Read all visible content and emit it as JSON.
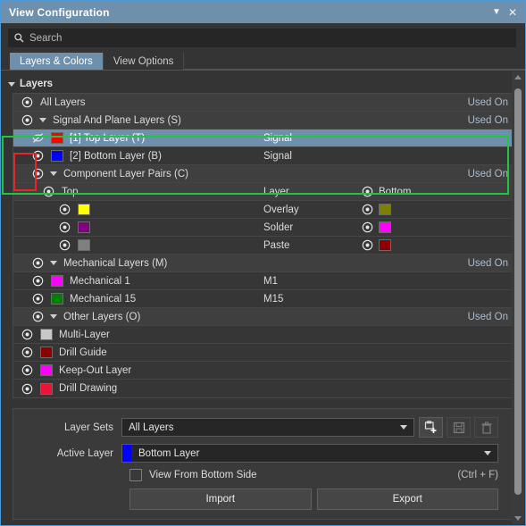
{
  "window": {
    "title": "View Configuration",
    "collapse_icon": "chevron-down-icon",
    "close_icon": "close-icon",
    "titlebar_color": "#6e90ad"
  },
  "search": {
    "placeholder": "Search",
    "value": "",
    "icon": "search-icon"
  },
  "tabs": [
    {
      "label": "Layers & Colors",
      "active": true
    },
    {
      "label": "View Options",
      "active": false
    }
  ],
  "layers_group": {
    "label": "Layers",
    "expanded": true
  },
  "columns": {
    "layer": "Layer",
    "bottom": "Bottom",
    "top": "Top"
  },
  "used_on_label": "Used On",
  "tree": [
    {
      "kind": "group",
      "indent": 0,
      "label": "All Layers",
      "eye": "visible",
      "used_on": true,
      "expander": false
    },
    {
      "kind": "group",
      "indent": 0,
      "label": "Signal And Plane Layers (S)",
      "eye": "visible",
      "used_on": true,
      "expander": true,
      "expanded": true
    },
    {
      "kind": "leaf",
      "indent": 1,
      "label": "[1] Top Layer (T)",
      "eye": "hidden",
      "swatch": "#ff0000",
      "layer_type": "Signal",
      "selected": true
    },
    {
      "kind": "leaf",
      "indent": 1,
      "label": "[2] Bottom Layer (B)",
      "eye": "visible",
      "swatch": "#0000ff",
      "layer_type": "Signal",
      "selected": false
    },
    {
      "kind": "group",
      "indent": 1,
      "label": "Component Layer Pairs (C)",
      "eye": "visible",
      "used_on": true,
      "expander": true,
      "expanded": true
    },
    {
      "kind": "pairhdr",
      "indent": 2,
      "label": "Top",
      "eye": "visible",
      "layer_col": "Layer",
      "bottom_label": "Bottom",
      "bottom_eye": "visible"
    },
    {
      "kind": "pair",
      "indent": 3,
      "top_eye": "visible",
      "top_swatch": "#ffff00",
      "layer_col": "Overlay",
      "bottom_eye": "visible",
      "bottom_swatch": "#808000"
    },
    {
      "kind": "pair",
      "indent": 3,
      "top_eye": "visible",
      "top_swatch": "#800080",
      "layer_col": "Solder",
      "bottom_eye": "visible",
      "bottom_swatch": "#ff00ff"
    },
    {
      "kind": "pair",
      "indent": 3,
      "top_eye": "visible",
      "top_swatch": "#808080",
      "layer_col": "Paste",
      "bottom_eye": "visible",
      "bottom_swatch": "#8b0000"
    },
    {
      "kind": "group",
      "indent": 1,
      "label": "Mechanical Layers (M)",
      "eye": "visible",
      "used_on": true,
      "expander": true,
      "expanded": true
    },
    {
      "kind": "leaf",
      "indent": 1,
      "label": "Mechanical 1",
      "eye": "visible",
      "swatch": "#ff00ff",
      "layer_type": "M1",
      "selected": false
    },
    {
      "kind": "leaf",
      "indent": 1,
      "label": "Mechanical 15",
      "eye": "visible",
      "swatch": "#008000",
      "layer_type": "M15",
      "selected": false
    },
    {
      "kind": "group",
      "indent": 1,
      "label": "Other Layers (O)",
      "eye": "visible",
      "used_on": true,
      "expander": true,
      "expanded": true
    },
    {
      "kind": "leaf",
      "indent": 0,
      "label": "Multi-Layer",
      "eye": "visible",
      "swatch": "#c8c8c8",
      "layer_type": "",
      "selected": false
    },
    {
      "kind": "leaf",
      "indent": 0,
      "label": "Drill Guide",
      "eye": "visible",
      "swatch": "#8b0000",
      "layer_type": "",
      "selected": false
    },
    {
      "kind": "leaf",
      "indent": 0,
      "label": "Keep-Out Layer",
      "eye": "visible",
      "swatch": "#ff00ff",
      "layer_type": "",
      "selected": false
    },
    {
      "kind": "leaf",
      "indent": 0,
      "label": "Drill Drawing",
      "eye": "visible",
      "swatch": "#f01038",
      "layer_type": "",
      "selected": false
    }
  ],
  "controls": {
    "layer_sets_label": "Layer Sets",
    "layer_sets_value": "All Layers",
    "active_layer_label": "Active Layer",
    "active_layer_value": "Bottom Layer",
    "active_layer_color": "#0000ff",
    "icon_buttons": [
      {
        "name": "add-layer-set-icon",
        "enabled": true
      },
      {
        "name": "save-layer-set-icon",
        "enabled": false
      },
      {
        "name": "delete-layer-set-icon",
        "enabled": false
      }
    ],
    "view_from_bottom_label": "View From Bottom Side",
    "view_from_bottom_checked": false,
    "view_from_bottom_shortcut": "(Ctrl + F)",
    "import_label": "Import",
    "export_label": "Export"
  },
  "annotations": {
    "green_highlight_color": "#22c442",
    "red_highlight_color": "#e8252a"
  }
}
